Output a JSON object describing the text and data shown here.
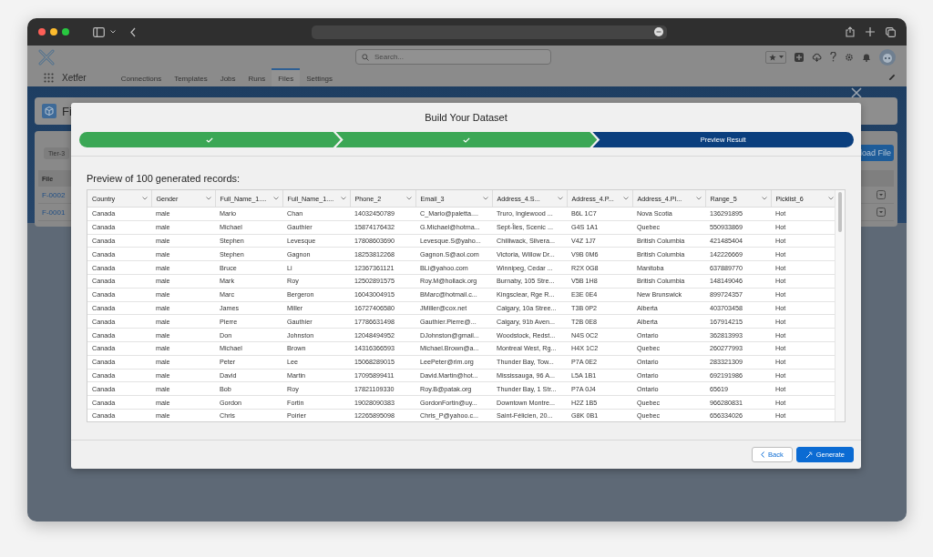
{
  "app": {
    "name": "Xetfer",
    "search": {
      "placeholder": "Search..."
    },
    "tabs": [
      {
        "label": "Connections",
        "selected": false
      },
      {
        "label": "Templates",
        "selected": false
      },
      {
        "label": "Jobs",
        "selected": false
      },
      {
        "label": "Runs",
        "selected": false
      },
      {
        "label": "Files",
        "selected": true
      },
      {
        "label": "Settings",
        "selected": false
      }
    ]
  },
  "page": {
    "header_title": "Fi",
    "filter_chip": "Tier-3",
    "upload_button": "load File",
    "table": {
      "column_1": "File",
      "rows": [
        "F-0002",
        "F-0001"
      ]
    }
  },
  "dialog": {
    "title": "Build Your Dataset",
    "steps": [
      {
        "done": true,
        "selected": false
      },
      {
        "done": true,
        "selected": false
      },
      {
        "label": "Preview Result",
        "done": false,
        "selected": true
      }
    ],
    "subtitle": "Preview of 100 generated records:",
    "table": {
      "columns": [
        "Country",
        "Gender",
        "Full_Name_1....",
        "Full_Name_1....",
        "Phone_2",
        "Email_3",
        "Address_4.S...",
        "Address_4.P...",
        "Address_4.Pl...",
        "Range_5",
        "Picklist_6"
      ],
      "rows": [
        [
          "Canada",
          "male",
          "Mario",
          "Chan",
          "14032450789",
          "C_Mario@paletta....",
          "Truro, Inglewood ...",
          "B6L 1C7",
          "Nova Scotia",
          "136291895",
          "Hot"
        ],
        [
          "Canada",
          "male",
          "Michael",
          "Gauthier",
          "15874176432",
          "G.Michael@hotma...",
          "Sept-Îles, Scenic ...",
          "G4S 1A1",
          "Quebec",
          "550933869",
          "Hot"
        ],
        [
          "Canada",
          "male",
          "Stephen",
          "Levesque",
          "17808603690",
          "Levesque.S@yaho...",
          "Chilliwack, Silvera...",
          "V4Z 1J7",
          "British Columbia",
          "421485404",
          "Hot"
        ],
        [
          "Canada",
          "male",
          "Stephen",
          "Gagnon",
          "18253812268",
          "Gagnon.S@aol.com",
          "Victoria, Willow Dr...",
          "V9B 0M6",
          "British Columbia",
          "142226669",
          "Hot"
        ],
        [
          "Canada",
          "male",
          "Bruce",
          "Li",
          "12367361121",
          "BLi@yahoo.com",
          "Winnipeg, Cedar ...",
          "R2X 0G8",
          "Manitoba",
          "637889770",
          "Hot"
        ],
        [
          "Canada",
          "male",
          "Mark",
          "Roy",
          "12502891575",
          "Roy.M@hollack.org",
          "Burnaby, 105 Stre...",
          "V5B 1H8",
          "British Columbia",
          "148149046",
          "Hot"
        ],
        [
          "Canada",
          "male",
          "Marc",
          "Bergeron",
          "16043004915",
          "BMarc@hotmail.c...",
          "Kingsclear, Rge R...",
          "E3E 0E4",
          "New Brunswick",
          "899724357",
          "Hot"
        ],
        [
          "Canada",
          "male",
          "James",
          "Miller",
          "16727406580",
          "JMiller@cox.net",
          "Calgary, 10a Stree...",
          "T3B 0P2",
          "Alberta",
          "403703458",
          "Hot"
        ],
        [
          "Canada",
          "male",
          "Pierre",
          "Gauthier",
          "17786631498",
          "Gauthier.Pierre@...",
          "Calgary, 91b Aven...",
          "T2B 0E8",
          "Alberta",
          "167914215",
          "Hot"
        ],
        [
          "Canada",
          "male",
          "Don",
          "Johnston",
          "12048494952",
          "DJohnston@gmail...",
          "Woodstock, Redst...",
          "N4S 0C2",
          "Ontario",
          "362813993",
          "Hot"
        ],
        [
          "Canada",
          "male",
          "Michael",
          "Brown",
          "14316366593",
          "Michael.Brown@a...",
          "Montreal West, Rg...",
          "H4X 1C2",
          "Quebec",
          "260277993",
          "Hot"
        ],
        [
          "Canada",
          "male",
          "Peter",
          "Lee",
          "15068289015",
          "LeePeter@rim.org",
          "Thunder Bay, Tow...",
          "P7A 0E2",
          "Ontario",
          "283321309",
          "Hot"
        ],
        [
          "Canada",
          "male",
          "David",
          "Martin",
          "17095899411",
          "David.Martin@hot...",
          "Mississauga, 96 A...",
          "L5A 1B1",
          "Ontario",
          "692191986",
          "Hot"
        ],
        [
          "Canada",
          "male",
          "Bob",
          "Roy",
          "17821109330",
          "Roy.B@patak.org",
          "Thunder Bay, 1 Str...",
          "P7A 0J4",
          "Ontario",
          "65619",
          "Hot"
        ],
        [
          "Canada",
          "male",
          "Gordon",
          "Fortin",
          "19028090383",
          "GordonFortin@uy...",
          "Downtown Montre...",
          "H2Z 1B5",
          "Quebec",
          "966280831",
          "Hot"
        ],
        [
          "Canada",
          "male",
          "Chris",
          "Poirier",
          "12265895098",
          "Chris_P@yahoo.c...",
          "Saint-Félicien, 20...",
          "G8K 0B1",
          "Quebec",
          "656334026",
          "Hot"
        ]
      ]
    },
    "buttons": [
      {
        "label": "Back",
        "kind": "back"
      },
      {
        "label": "Generate",
        "kind": "generate"
      }
    ]
  }
}
